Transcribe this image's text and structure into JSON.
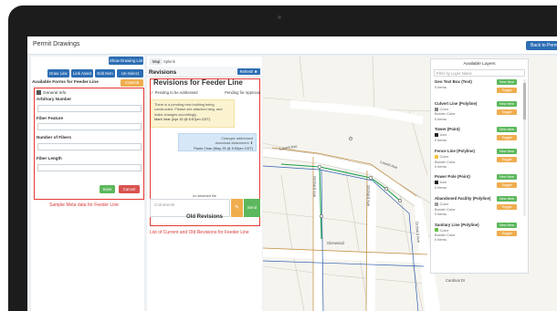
{
  "app": {
    "title": "Permit Drawings",
    "back_button": "Back to Perm"
  },
  "left": {
    "show_drawing_list": "Show Drawing List",
    "buttons": [
      "Draw Line",
      "Link Asset",
      "Edit Item",
      "Un-Select"
    ],
    "available_forms_label": "Available Forms for Feeder Line",
    "commit_button": "Commit",
    "form": {
      "section": "General Info",
      "fields": [
        "Arbitrary Number",
        "Fiber Feature",
        "Number of Fibers",
        "Fiber Length"
      ]
    },
    "save": "Save",
    "cancel": "Cancel",
    "caption": "Sample Meta data for Feeder Line"
  },
  "middle": {
    "tabs": [
      "Map",
      "Splunk"
    ],
    "revisions_title": "Revisions",
    "refresh": "Refresh",
    "subtitle": "Revisions for Feeder Line",
    "pending_left": "Pending to be Addressed",
    "pending_right": "Pending for Approval",
    "note_yellow": [
      "There is a pending new building being",
      "constructed. Please see attached dwg, and",
      "make changes accordingly.",
      "Mark Vear (Apr 15 @ 6:57pm CDT)"
    ],
    "note_blue": [
      "Changes addressed",
      "download attachment",
      "Paolo Chan (May 25 @ 5:53pm CDT)"
    ],
    "attach_label": "no attached file",
    "comments_placeholder": "Comments",
    "send": "Send",
    "old_revisions": "Old Revisions",
    "caption": "List of Current and Old Revisions for Feeder Line"
  },
  "map": {
    "road_labels": [
      "Laurel Ave",
      "Laurel Ave",
      "Orchard Ave",
      "Orchard Ave",
      "Orchard Ave",
      "Glenwood",
      "Cardinal Dr"
    ]
  },
  "layers": {
    "title": "Available Layers",
    "filter_placeholder": "Filter by Layer Name",
    "new_item": "New Item",
    "toggle": "Toggle",
    "items": [
      {
        "name": "Geo Text Box (Text)",
        "lines": [
          "0 items"
        ],
        "color": ""
      },
      {
        "name": "Culvert Line (Polyline)",
        "lines": [
          "Color",
          "Border Color",
          "0 items"
        ],
        "color": "#888888"
      },
      {
        "name": "Tower (Point)",
        "lines": [
          "Icon",
          "0 items"
        ],
        "color": "#222222"
      },
      {
        "name": "Fence Line (Polyline)",
        "lines": [
          "Color",
          "Border Color",
          "0 items"
        ],
        "color": "#f0c33c"
      },
      {
        "name": "Power Pole (Point)",
        "lines": [
          "Icon",
          "0 items"
        ],
        "color": "#222222"
      },
      {
        "name": "Abandoned Facility (Polyline)",
        "lines": [
          "Color",
          "Border Color",
          "0 items"
        ],
        "color": "#9e9e9e"
      },
      {
        "name": "Sanitary Line (Polyline)",
        "lines": [
          "Color",
          "Border Color",
          "0 items"
        ],
        "color": "#6abf4b"
      }
    ]
  }
}
